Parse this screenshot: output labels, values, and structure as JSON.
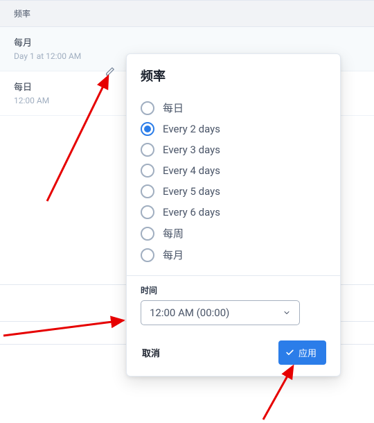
{
  "list": {
    "header": "频率",
    "items": [
      {
        "title": "每月",
        "sub": "Day 1 at 12:00 AM",
        "selected": true
      },
      {
        "title": "每日",
        "sub": "12:00 AM",
        "selected": false
      }
    ]
  },
  "popover": {
    "title": "频率",
    "options": [
      {
        "label": "每日",
        "selected": false
      },
      {
        "label": "Every 2 days",
        "selected": true
      },
      {
        "label": "Every 3 days",
        "selected": false
      },
      {
        "label": "Every 4 days",
        "selected": false
      },
      {
        "label": "Every 5 days",
        "selected": false
      },
      {
        "label": "Every 6 days",
        "selected": false
      },
      {
        "label": "每周",
        "selected": false
      },
      {
        "label": "每月",
        "selected": false
      }
    ],
    "time_label": "时间",
    "time_value": "12:00 AM (00:00)",
    "cancel_label": "取消",
    "apply_label": "应用"
  },
  "colors": {
    "accent": "#2b7de9",
    "arrow": "#e60000"
  }
}
